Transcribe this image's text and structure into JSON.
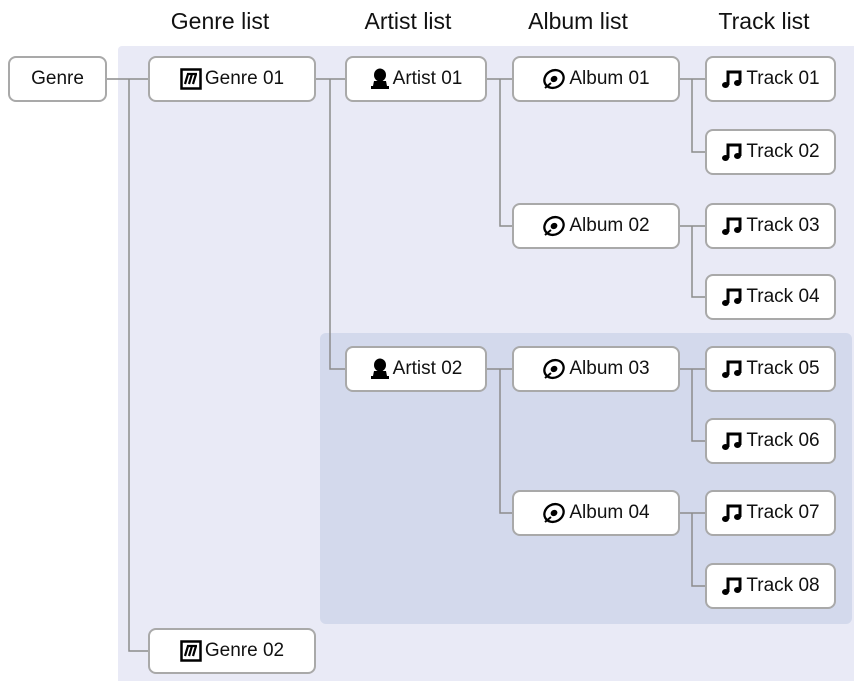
{
  "headers": {
    "genre_list": "Genre list",
    "artist_list": "Artist list",
    "album_list": "Album list",
    "track_list": "Track list"
  },
  "root": {
    "label": "Genre"
  },
  "genres": [
    {
      "label": "Genre 01"
    },
    {
      "label": "Genre 02"
    }
  ],
  "artists": [
    {
      "label": "Artist 01"
    },
    {
      "label": "Artist 02"
    }
  ],
  "albums": [
    {
      "label": "Album 01"
    },
    {
      "label": "Album 02"
    },
    {
      "label": "Album 03"
    },
    {
      "label": "Album 04"
    }
  ],
  "tracks": [
    {
      "label": "Track 01"
    },
    {
      "label": "Track 02"
    },
    {
      "label": "Track 03"
    },
    {
      "label": "Track 04"
    },
    {
      "label": "Track 05"
    },
    {
      "label": "Track 06"
    },
    {
      "label": "Track 07"
    },
    {
      "label": "Track 08"
    }
  ],
  "icons": {
    "genre": "genre-icon",
    "artist": "artist-icon",
    "album": "album-icon",
    "track": "music-note-icon"
  },
  "colors": {
    "outer_panel": "#e9eaf6",
    "inner_panel": "#d3d9ec",
    "node_border": "#a9a9a9",
    "connector": "#8c8c8c"
  }
}
